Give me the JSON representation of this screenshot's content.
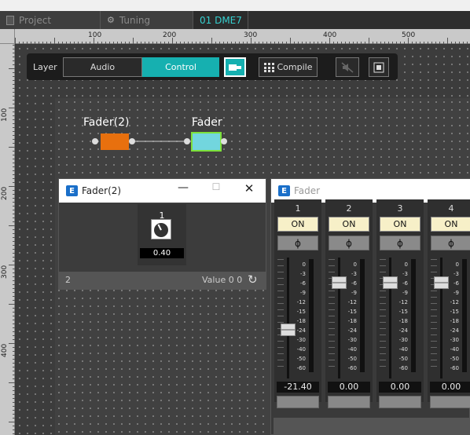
{
  "tabs": [
    {
      "label": "Project",
      "icon": "document-icon"
    },
    {
      "label": "Tuning",
      "icon": "tuning-grid-icon"
    },
    {
      "label": "01 DME7"
    }
  ],
  "ruler": {
    "top_ticks": [
      "100",
      "200",
      "300",
      "400",
      "500"
    ],
    "left_ticks": [
      "100",
      "200",
      "300",
      "400"
    ]
  },
  "layer_bar": {
    "label": "Layer",
    "audio": "Audio",
    "control": "Control",
    "compile": "Compile"
  },
  "nodes": {
    "fader2": "Fader(2)",
    "fader": "Fader"
  },
  "colors": {
    "accent": "#16b0b0",
    "fader2_block": "#e8700e",
    "fader_block": "#72d6de",
    "link": "#cfcfcf"
  },
  "fader2_window": {
    "title": "Fader(2)",
    "channel": "1",
    "knob_value": "0.40",
    "knob_fraction": 0.4,
    "footer_left": "2",
    "footer_right": "Value 0 0"
  },
  "fader_window": {
    "title": "Fader",
    "scale": [
      "0",
      "-3",
      "-6",
      "-9",
      "-12",
      "-15",
      "-18",
      "-24",
      "-30",
      "-40",
      "-50",
      "-60"
    ],
    "channels": [
      {
        "num": "1",
        "on": "ON",
        "phase": "ϕ",
        "value": "-21.40",
        "level_db": -21.4
      },
      {
        "num": "2",
        "on": "ON",
        "phase": "ϕ",
        "value": "0.00",
        "level_db": 0
      },
      {
        "num": "3",
        "on": "ON",
        "phase": "ϕ",
        "value": "0.00",
        "level_db": 0
      },
      {
        "num": "4",
        "on": "ON",
        "phase": "ϕ",
        "value": "0.00",
        "level_db": 0
      }
    ]
  }
}
